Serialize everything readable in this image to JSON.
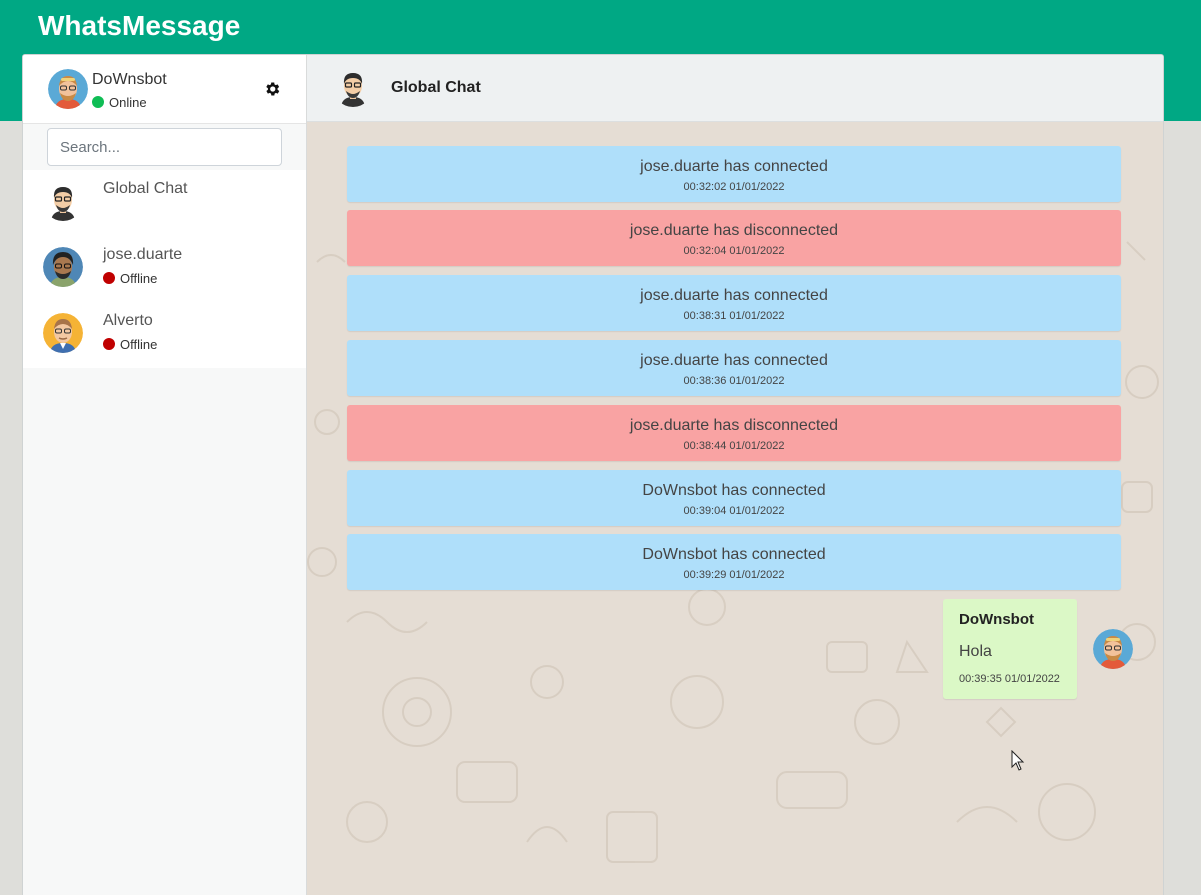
{
  "app": {
    "title": "WhatsMessage",
    "brand_color": "#00a884"
  },
  "user": {
    "name": "DoWnsbot",
    "status": "Online",
    "settings_icon": "gear-icon"
  },
  "search": {
    "placeholder": "Search..."
  },
  "contacts": [
    {
      "name": "Global Chat",
      "status": ""
    },
    {
      "name": "jose.duarte",
      "status": "Offline"
    },
    {
      "name": "Alverto",
      "status": "Offline"
    }
  ],
  "chat": {
    "title": "Global Chat",
    "notices": [
      {
        "text": "jose.duarte has connected",
        "time": "00:32:02 01/01/2022",
        "kind": "connected"
      },
      {
        "text": "jose.duarte has disconnected",
        "time": "00:32:04 01/01/2022",
        "kind": "disconnected"
      },
      {
        "text": "jose.duarte has connected",
        "time": "00:38:31 01/01/2022",
        "kind": "connected"
      },
      {
        "text": "jose.duarte has connected",
        "time": "00:38:36 01/01/2022",
        "kind": "connected"
      },
      {
        "text": "jose.duarte has disconnected",
        "time": "00:38:44 01/01/2022",
        "kind": "disconnected"
      },
      {
        "text": "DoWnsbot has connected",
        "time": "00:39:04 01/01/2022",
        "kind": "connected"
      },
      {
        "text": "DoWnsbot has connected",
        "time": "00:39:29 01/01/2022",
        "kind": "connected"
      }
    ],
    "message": {
      "author": "DoWnsbot",
      "text": "Hola",
      "time": "00:39:35 01/01/2022"
    }
  },
  "colors": {
    "connected": "#afdffa",
    "disconnected": "#f9a3a3",
    "own_message": "#dbf8c6",
    "online": "#0fbd55",
    "offline": "#c00000"
  }
}
